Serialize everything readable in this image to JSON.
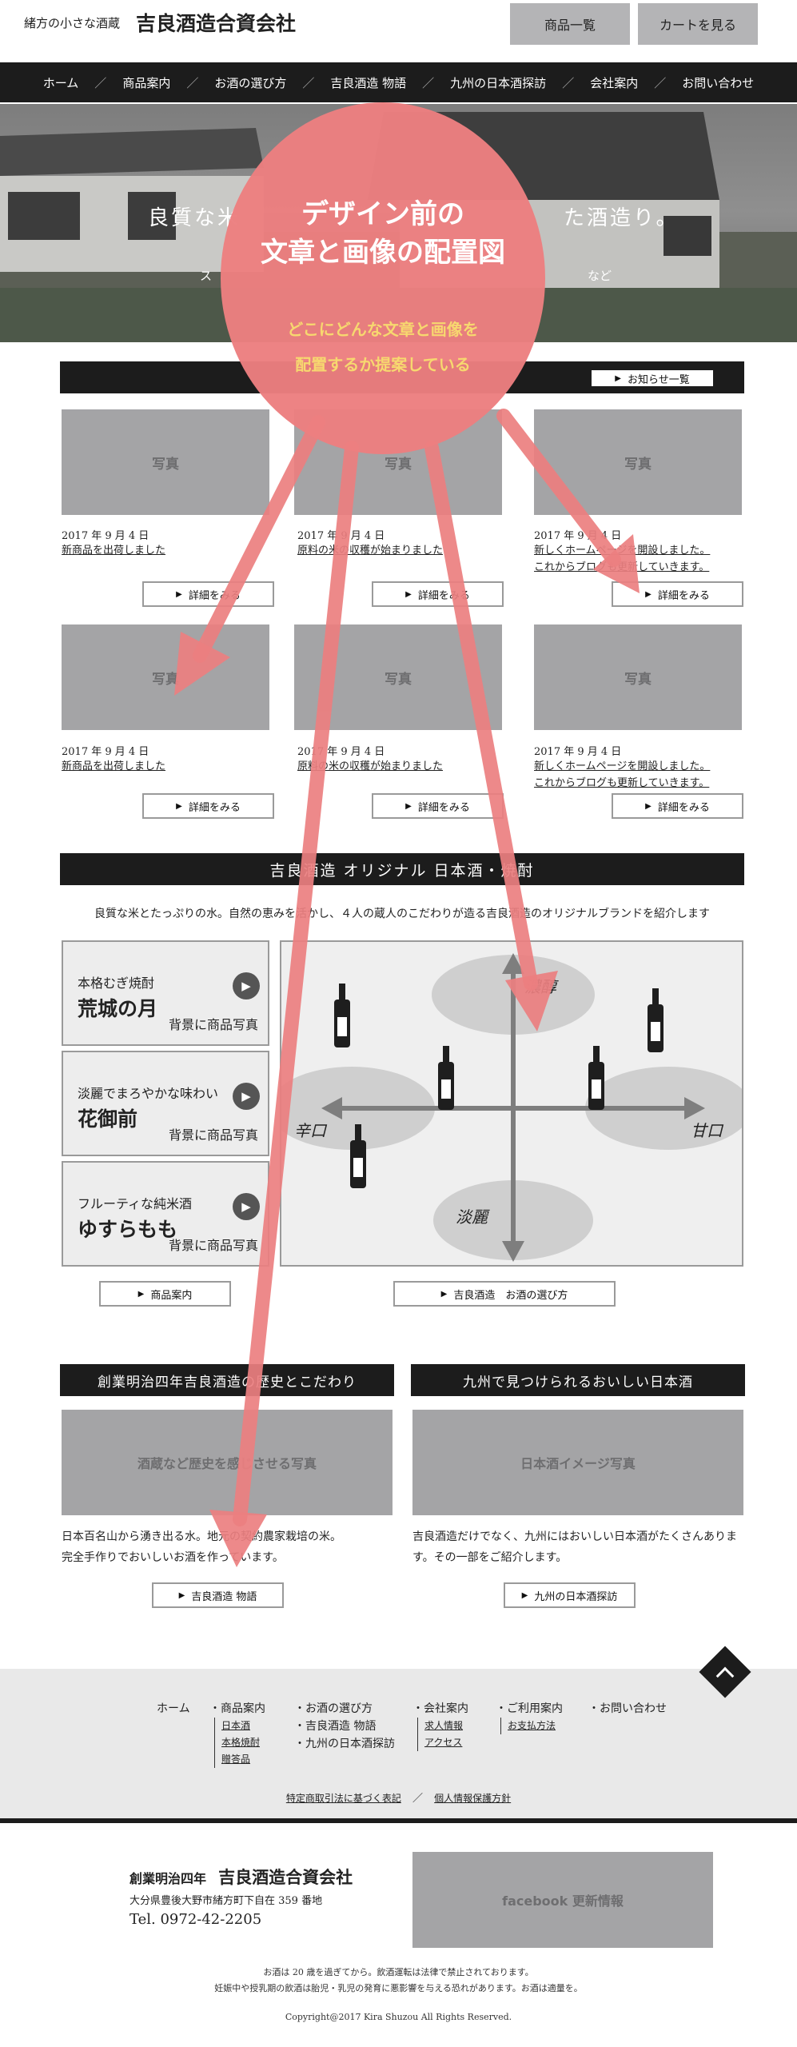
{
  "header": {
    "tagline": "緒方の小さな酒蔵",
    "company": "吉良酒造合資会社",
    "btn_products": "商品一覧",
    "btn_cart": "カートを見る"
  },
  "nav": [
    "ホーム",
    "商品案内",
    "お酒の選び方",
    "吉良酒造 物語",
    "九州の日本酒探訪",
    "会社案内",
    "お問い合わせ"
  ],
  "nav_sep": "／",
  "hero": {
    "text_left": "良質な米",
    "text_right": "た酒造り。",
    "subtext_left": "ス",
    "subtext_right": "など"
  },
  "annotation": {
    "title_line1": "デザイン前の",
    "title_line2": "文章と画像の配置図",
    "sub_line1": "どこにどんな文章と画像を",
    "sub_line2": "配置するか提案している"
  },
  "news": {
    "all_button": "お知らせ一覧",
    "photo_label": "写真",
    "detail_label": "詳細をみる",
    "items": [
      {
        "date": "2017 年 9 月 4 日",
        "line1": "新商品を出荷しました",
        "line2": ""
      },
      {
        "date": "2017 年 9 月 4 日",
        "line1": "原料の米の収穫が始まりました",
        "line2": ""
      },
      {
        "date": "2017 年 9 月 4 日",
        "line1": "新しくホームページを開設しました。",
        "line2": "これからブログも更新していきます。"
      },
      {
        "date": "2017 年 9 月 4 日",
        "line1": "新商品を出荷しました",
        "line2": ""
      },
      {
        "date": "2017 年 9 月 4 日",
        "line1": "原料の米の収穫が始まりました",
        "line2": ""
      },
      {
        "date": "2017 年 9 月 4 日",
        "line1": "新しくホームページを開設しました。",
        "line2": "これからブログも更新していきます。"
      }
    ]
  },
  "original": {
    "title": "吉良酒造 オリジナル 日本酒・焼酎",
    "intro": "良質な米とたっぷりの水。自然の恵みを活かし、４人の蔵人のこだわりが造る吉良酒造のオリジナルブランドを紹介します",
    "products": [
      {
        "sub": "本格むぎ焼酎",
        "name": "荒城の月",
        "photo": "背景に商品写真"
      },
      {
        "sub": "淡麗でまろやかな味わい",
        "name": "花御前",
        "photo": "背景に商品写真"
      },
      {
        "sub": "フルーティな純米酒",
        "name": "ゆすらもも",
        "photo": "背景に商品写真"
      }
    ],
    "chart_labels": {
      "top": "濃醇",
      "bottom": "淡麗",
      "left": "辛口",
      "right": "甘口"
    },
    "btn_products": "商品案内",
    "btn_choose": "吉良酒造　お酒の選び方"
  },
  "history": {
    "title": "創業明治四年吉良酒造の歴史とこだわり",
    "photo": "酒蔵など歴史を感じさせる写真",
    "text1": "日本百名山から湧き出る水。地元の契約農家栽培の米。",
    "text2": "完全手作りでおいしいお酒を作っています。",
    "button": "吉良酒造 物語"
  },
  "kyushu": {
    "title": "九州で見つけられるおいしい日本酒",
    "photo": "日本酒イメージ写真",
    "text1": "吉良酒造だけでなく、九州にはおいしい日本酒がたくさんあります。その一部をご紹介します。",
    "button": "九州の日本酒探訪"
  },
  "footer": {
    "home": "ホーム",
    "products": "商品案内",
    "products_sub": [
      "日本酒",
      "本格焼酎",
      "贈答品"
    ],
    "choose": "お酒の選び方",
    "story": "吉良酒造 物語",
    "kyushu": "九州の日本酒探訪",
    "company": "会社案内",
    "company_sub": [
      "求人情報",
      "アクセス"
    ],
    "guide": "ご利用案内",
    "guide_sub": [
      "お支払方法"
    ],
    "contact": "お問い合わせ",
    "legal": "特定商取引法に基づく表記",
    "privacy": "個人情報保護方針",
    "legal_sep": "／",
    "founded": "創業明治四年",
    "name": "吉良酒造合資会社",
    "address": "大分県豊後大野市緒方町下自在 359 番地",
    "tel": "Tel. 0972-42-2205",
    "facebook": "facebook 更新情報",
    "notice1": "お酒は 20 歳を過ぎてから。飲酒運転は法律で禁止されております。",
    "notice2": "妊娠中や授乳期の飲酒は胎児・乳児の発育に悪影響を与える恐れがあります。お酒は適量を。",
    "copyright": "Copyright@2017 Kira Shuzou All Rights Reserved."
  },
  "colors": {
    "accent": "#ec7f80",
    "annotation_sub": "#f7d86f",
    "dark": "#1c1c1c",
    "gray_btn": "#b4b4b6"
  }
}
